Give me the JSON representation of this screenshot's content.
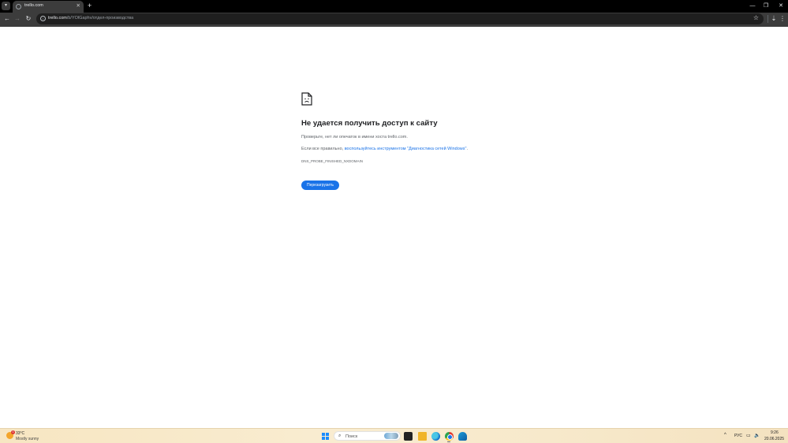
{
  "browser": {
    "tab": {
      "title": "trello.com",
      "close_glyph": "✕"
    },
    "tab_search_glyph": "▾",
    "new_tab_glyph": "+",
    "window_controls": {
      "minimize": "—",
      "maximize": "❐",
      "close": "✕"
    },
    "toolbar": {
      "back_glyph": "←",
      "forward_glyph": "→",
      "reload_glyph": "↻",
      "bookmark_glyph": "☆",
      "menu_glyph": "⋮",
      "extensions_glyph": "⇣"
    },
    "address": {
      "host": "trello.com",
      "path": "/b/YOlGaphv/отдел-производства"
    }
  },
  "error_page": {
    "title": "Не удается получить доступ к сайту",
    "line1": "Проверьте, нет ли опечаток в имени хоста trello.com.",
    "line2_prefix": "Если все правильно, ",
    "line2_link": "воспользуйтесь инструментом \"Диагностика сетей Windows\"",
    "line2_suffix": ".",
    "error_code": "DNS_PROBE_FINISHED_NXDOMAIN",
    "reload_label": "Перезагрузить"
  },
  "taskbar": {
    "weather": {
      "temp": "33°C",
      "desc": "Mostly sunny",
      "badge": "1"
    },
    "search_placeholder": "Поиск",
    "search_glyph": "⌕",
    "tray": {
      "chevron": "^",
      "language": "РУС",
      "network_glyph": "▭",
      "volume_glyph": "🔈",
      "time": "9:26",
      "date": "20.06.2025"
    }
  },
  "colors": {
    "link": "#1a73e8",
    "button": "#1a73e8",
    "title": "#202124",
    "text": "#5f6368"
  }
}
